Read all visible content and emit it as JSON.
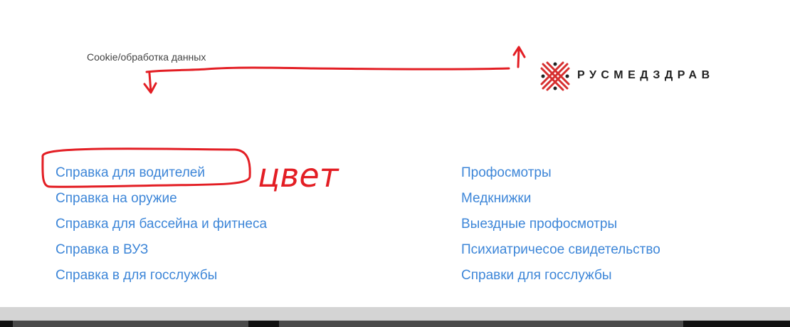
{
  "header": {
    "cookie_link": "Cookie/обработка данных",
    "logo_text": "РУСМЕДЗДРАВ"
  },
  "links_left": [
    "Справка для водителей",
    "Справка на оружие",
    "Справка для бассейна и фитнеса",
    "Справка в ВУЗ",
    "Справка в для госслужбы"
  ],
  "links_right": [
    "Профосмотры",
    "Медкнижки",
    "Выездные профосмотры",
    "Психиатричесое свидетельство",
    "Справки для госслужбы"
  ],
  "annotation": {
    "text": "цвет",
    "color": "#e31e24"
  },
  "colors": {
    "link": "#3d86d8",
    "logo_red": "#d62f2f",
    "logo_dark": "#222222"
  }
}
